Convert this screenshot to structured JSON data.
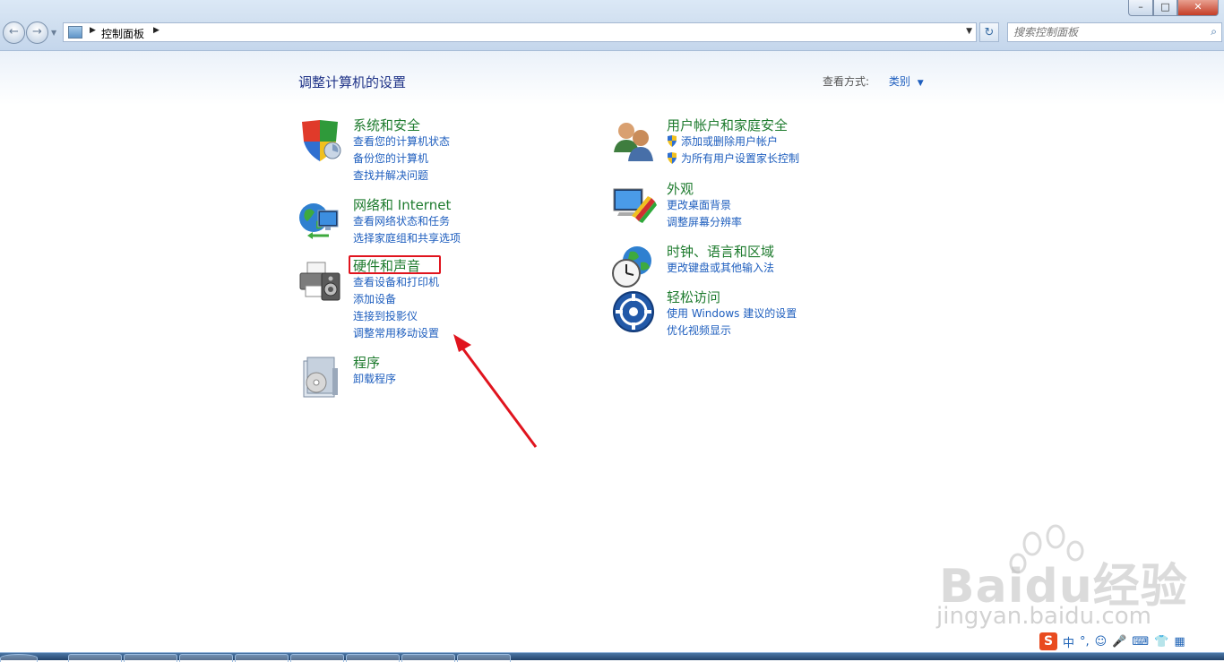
{
  "window": {
    "min_label": "–",
    "max_label": "□",
    "close_label": "✕"
  },
  "nav": {
    "back_glyph": "←",
    "forward_glyph": "→",
    "drop_glyph": "▼"
  },
  "address": {
    "crumb": "控制面板",
    "arrow": "▶",
    "dropdown": "▼"
  },
  "refresh_glyph": "↻",
  "search": {
    "placeholder": "搜索控制面板",
    "icon": "search-icon",
    "glyph": "⌕"
  },
  "page": {
    "title": "调整计算机的设置",
    "view_by_label": "查看方式:",
    "view_by_value": "类别",
    "caret": "▼"
  },
  "categories_left": [
    {
      "title": "系统和安全",
      "icon": "shield-icon",
      "links": [
        "查看您的计算机状态",
        "备份您的计算机",
        "查找并解决问题"
      ]
    },
    {
      "title": "网络和 Internet",
      "icon": "network-globe-icon",
      "links": [
        "查看网络状态和任务",
        "选择家庭组和共享选项"
      ]
    },
    {
      "title": "硬件和声音",
      "icon": "printer-speaker-icon",
      "links": [
        "查看设备和打印机",
        "添加设备",
        "连接到投影仪",
        "调整常用移动设置"
      ]
    },
    {
      "title": "程序",
      "icon": "programs-icon",
      "links": [
        "卸载程序"
      ]
    }
  ],
  "categories_right": [
    {
      "title": "用户帐户和家庭安全",
      "icon": "users-icon",
      "links": [
        "添加或删除用户帐户",
        "为所有用户设置家长控制"
      ]
    },
    {
      "title": "外观",
      "icon": "appearance-monitor-icon",
      "links": [
        "更改桌面背景",
        "调整屏幕分辨率"
      ]
    },
    {
      "title": "时钟、语言和区域",
      "icon": "clock-globe-icon",
      "links": [
        "更改键盘或其他输入法"
      ]
    },
    {
      "title": "轻松访问",
      "icon": "ease-of-access-icon",
      "links": [
        "使用 Windows 建议的设置",
        "优化视频显示"
      ]
    }
  ],
  "watermark": {
    "brand": "Baidu经验",
    "url": "jingyan.baidu.com"
  },
  "tray": {
    "ime_logo": "S",
    "lang": "中",
    "punct": "°,",
    "emoji": "☺",
    "mic": "🎤",
    "keyboard": "⌨",
    "shirt": "👕",
    "grid": "▦"
  },
  "colors": {
    "link": "#1e5ebe",
    "category_title": "#1e7b2e",
    "page_title": "#1e3287",
    "highlight": "#e0141e"
  }
}
